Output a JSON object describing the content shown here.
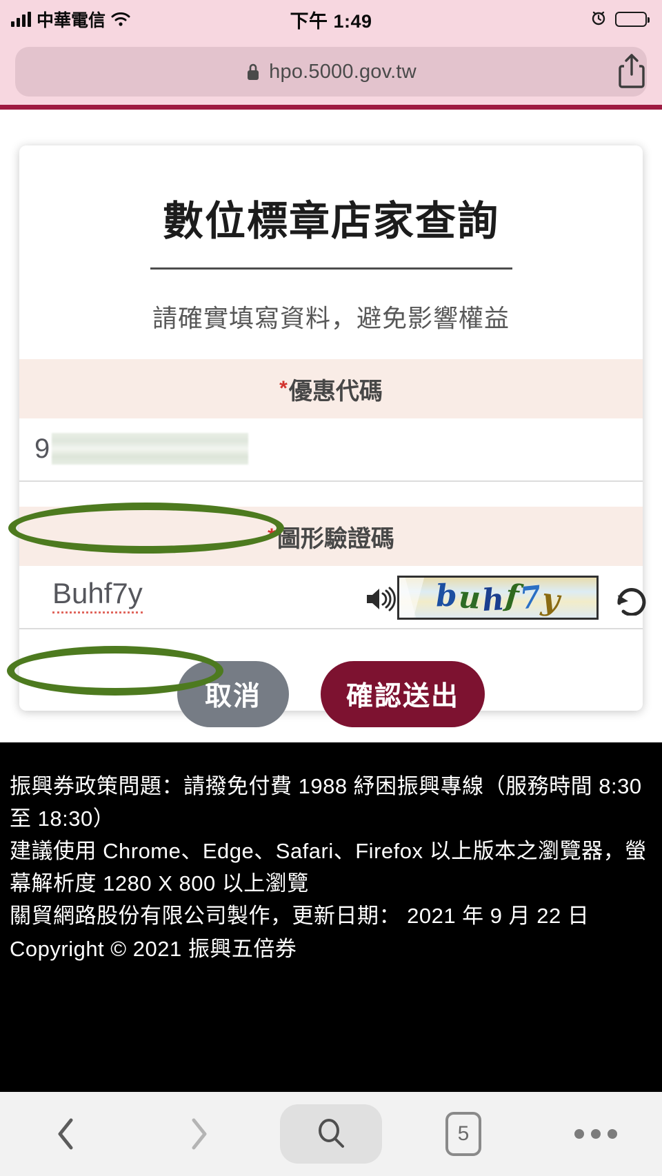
{
  "status_bar": {
    "carrier": "中華電信",
    "time": "下午 1:49",
    "signal_icon": "signal-bars-icon",
    "wifi_icon": "wifi-icon",
    "alarm_icon": "alarm-clock-icon",
    "battery_icon": "battery-icon"
  },
  "browser": {
    "url": "hpo.5000.gov.tw",
    "lock_icon": "lock-icon",
    "share_icon": "share-icon",
    "accent_color": "#9e1b42"
  },
  "card": {
    "title": "數位標章店家查詢",
    "subtitle": "請確實填寫資料，避免影響權益",
    "fields": [
      {
        "required_mark": "*",
        "label": "優惠代碼",
        "value_prefix": "9",
        "value_redacted": true,
        "annotated": true
      },
      {
        "required_mark": "*",
        "label": "圖形驗證碼",
        "value": "Buhf7y",
        "annotated": true,
        "speaker_icon": "speaker-icon",
        "refresh_icon": "refresh-icon",
        "captcha_image_text": "buhf7y",
        "captcha_letters": [
          {
            "ch": "b",
            "color": "#1c4fa1"
          },
          {
            "ch": "u",
            "color": "#2e6b24"
          },
          {
            "ch": "h",
            "color": "#1b3f8f"
          },
          {
            "ch": "f",
            "color": "#2f6a1f"
          },
          {
            "ch": "7",
            "color": "#2a6fc4"
          },
          {
            "ch": "y",
            "color": "#8a6b12"
          }
        ]
      }
    ],
    "buttons": {
      "cancel": "取消",
      "submit": "確認送出"
    },
    "label_bg_color": "#f9ece6",
    "required_star_color": "#d2322d",
    "submit_color": "#7d1230",
    "cancel_color": "#767c85",
    "annotation_color": "#4d7a1f"
  },
  "footer": {
    "lines": [
      "振興券政策問題：請撥免付費 1988 紓困振興專線（服務時間 8:30 至 18:30）",
      "建議使用 Chrome、Edge、Safari、Firefox 以上版本之瀏覽器，螢幕解析度 1280 X 800 以上瀏覽",
      "關貿網路股份有限公司製作，更新日期： 2021 年 9 月 22 日",
      "Copyright © 2021 振興五倍券"
    ]
  },
  "toolbar": {
    "back_icon": "chevron-left-icon",
    "forward_icon": "chevron-right-icon",
    "search_icon": "search-icon",
    "tabs_count": "5",
    "more_icon": "ellipsis-icon"
  }
}
